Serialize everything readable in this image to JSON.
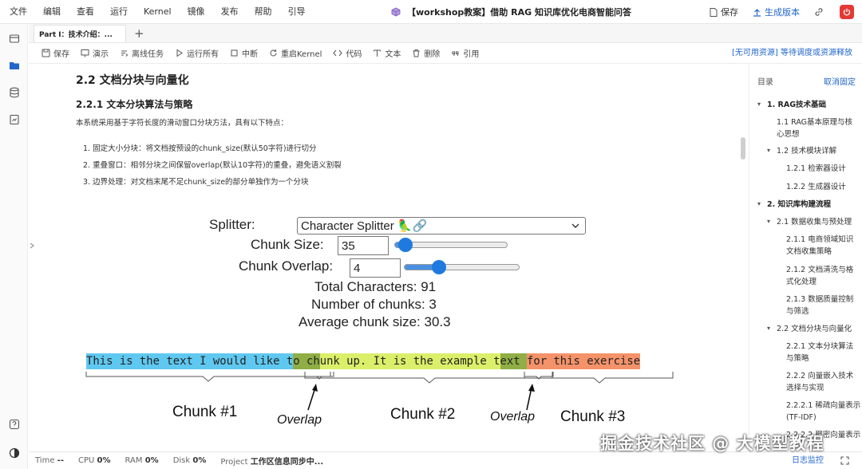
{
  "menubar": {
    "items": [
      "文件",
      "编辑",
      "查看",
      "运行",
      "Kernel",
      "镜像",
      "发布",
      "帮助",
      "引导"
    ],
    "notebook_title": "【workshop教案】借助 RAG 知识库优化电商智能问答",
    "save_label": "保存",
    "publish_label": "生成版本"
  },
  "tabs": [
    {
      "label": "Part I：技术介绍：..."
    }
  ],
  "toolbar": {
    "save": "保存",
    "present": "演示",
    "offline": "离线任务",
    "run_all": "运行所有",
    "interrupt": "中断",
    "restart": "重启Kernel",
    "code": "代码",
    "text": "文本",
    "delete": "删除",
    "cite": "引用",
    "resource_status": "[无可用资源] 等待调度或资源释放"
  },
  "content": {
    "h2": "2.2 文档分块与向量化",
    "h3": "2.2.1 文本分块算法与策略",
    "intro": "本系统采用基于字符长度的滑动窗口分块方法，具有以下特点：",
    "features": [
      "1. 固定大小分块：将文档按预设的chunk_size(默认50字符)进行切分",
      "2. 重叠窗口：相邻分块之间保留overlap(默认10字符)的重叠，避免语义割裂",
      "3. 边界处理：对文档末尾不足chunk_size的部分单独作为一个分块"
    ]
  },
  "figure": {
    "splitter_label": "Splitter:",
    "splitter_value": "Character Splitter 🦜🔗",
    "chunk_size_label": "Chunk Size:",
    "chunk_size_value": "35",
    "chunk_size_slider": 0.03,
    "chunk_overlap_label": "Chunk Overlap:",
    "chunk_overlap_value": "4",
    "chunk_overlap_slider": 0.27,
    "total_chars": "Total Characters: 91",
    "num_chunks": "Number of chunks: 3",
    "avg_chunk": "Average chunk size: 30.3",
    "segments": [
      {
        "text": "This is the text I would like t",
        "color": "#5fc8f0"
      },
      {
        "text": "o ch",
        "color": "#8fae45"
      },
      {
        "text": "unk up. It is the example t",
        "color": "#dcef6a"
      },
      {
        "text": "ext ",
        "color": "#8fae45"
      },
      {
        "text": "for this exercise",
        "color": "#f4926a"
      }
    ],
    "chunk1": "Chunk #1",
    "chunk2": "Chunk #2",
    "chunk3": "Chunk #3",
    "overlap1": "Overlap",
    "overlap2": "Overlap"
  },
  "toc": {
    "title": "目录",
    "unpin": "取消固定",
    "items": [
      {
        "label": "1. RAG技术基础"
      },
      {
        "label": "1.1 RAG基本原理与核"
      },
      {
        "label": "心思想"
      },
      {
        "label": "1.2 技术模块详解"
      },
      {
        "label": "1.2.1 检索器设计"
      },
      {
        "label": "1.2.2 生成器设计"
      },
      {
        "label": "2. 知识库构建流程"
      },
      {
        "label": "2.1 数据收集与预处理"
      },
      {
        "label": "2.1.1 电商领域知识"
      },
      {
        "label": "文档收集策略"
      },
      {
        "label": "2.1.2 文档清洗与格"
      },
      {
        "label": "式化处理"
      },
      {
        "label": "2.1.3 数据质量控制"
      },
      {
        "label": "与筛选"
      },
      {
        "label": "2.2 文档分块与向量化"
      },
      {
        "label": "2.2.1 文本分块算法"
      },
      {
        "label": "与策略"
      },
      {
        "label": "2.2.2 向量嵌入技术"
      },
      {
        "label": "选择与实现"
      },
      {
        "label": "2.2.2.1 稀疏向量表示"
      },
      {
        "label": "(TF-IDF)"
      },
      {
        "label": "2.2.2.2 稠密向量表示"
      }
    ]
  },
  "statusbar": {
    "time_label": "Time",
    "time_value": "--",
    "cpu_label": "CPU",
    "cpu_value": "0%",
    "ram_label": "RAM",
    "ram_value": "0%",
    "disk_label": "Disk",
    "disk_value": "0%",
    "project_label": "Project",
    "project_value": "工作区信息同步中...",
    "log_monitor": "日志监控"
  },
  "watermark": "掘金技术社区 @ 大模型教程",
  "colors": {
    "accent": "#2266cc",
    "danger": "#e53935"
  }
}
